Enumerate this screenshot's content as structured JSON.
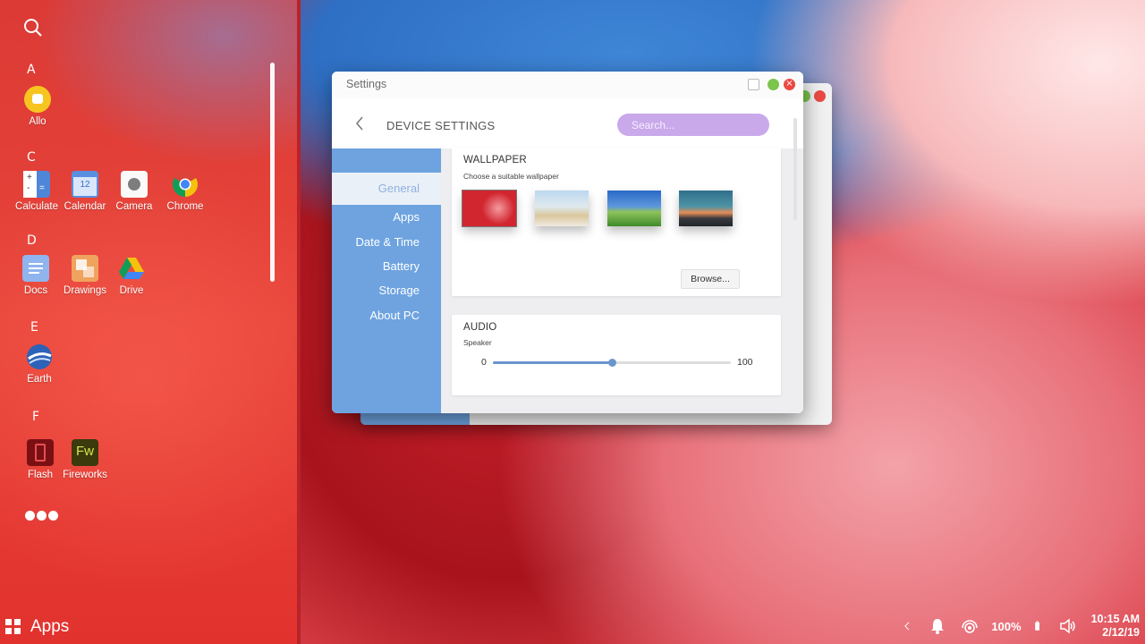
{
  "launcher": {
    "sections": [
      {
        "letter": "A"
      },
      {
        "letter": "C"
      },
      {
        "letter": "D"
      },
      {
        "letter": "E"
      },
      {
        "letter": "F"
      }
    ],
    "apps": [
      {
        "label": "Allo",
        "icon": "allo-icon"
      },
      {
        "label": "Calculate",
        "icon": "calculator-icon"
      },
      {
        "label": "Calendar",
        "icon": "calendar-icon",
        "icon_text": "12"
      },
      {
        "label": "Camera",
        "icon": "camera-icon"
      },
      {
        "label": "Chrome",
        "icon": "chrome-icon"
      },
      {
        "label": "Docs",
        "icon": "docs-icon"
      },
      {
        "label": "Drawings",
        "icon": "drawings-icon"
      },
      {
        "label": "Drive",
        "icon": "drive-icon"
      },
      {
        "label": "Earth",
        "icon": "earth-icon"
      },
      {
        "label": "Flash",
        "icon": "flash-icon"
      },
      {
        "label": "Fireworks",
        "icon": "fireworks-icon",
        "icon_text": "Fw"
      }
    ]
  },
  "taskbar": {
    "apps_label": "Apps",
    "battery_percent": "100%",
    "time": "10:15 AM",
    "date": "2/12/19"
  },
  "window": {
    "title": "Settings",
    "header_title": "DEVICE SETTINGS",
    "search_placeholder": "Search...",
    "sidebar": [
      {
        "label": "General",
        "active": true
      },
      {
        "label": "Apps"
      },
      {
        "label": "Date & Time"
      },
      {
        "label": "Battery"
      },
      {
        "label": "Storage"
      },
      {
        "label": "About PC"
      }
    ],
    "wallpaper": {
      "title": "WALLPAPER",
      "subtitle": "Choose a suitable wallpaper",
      "browse_label": "Browse..."
    },
    "audio": {
      "title": "AUDIO",
      "speaker_label": "Speaker",
      "min": "0",
      "max": "100",
      "level_fraction": 0.5
    }
  },
  "colors": {
    "sidebar": "#6ea3e0",
    "search": "#c9a9ea",
    "slider": "#6a96cd",
    "close": "#ea4a44",
    "minimize": "#7cc44c"
  }
}
